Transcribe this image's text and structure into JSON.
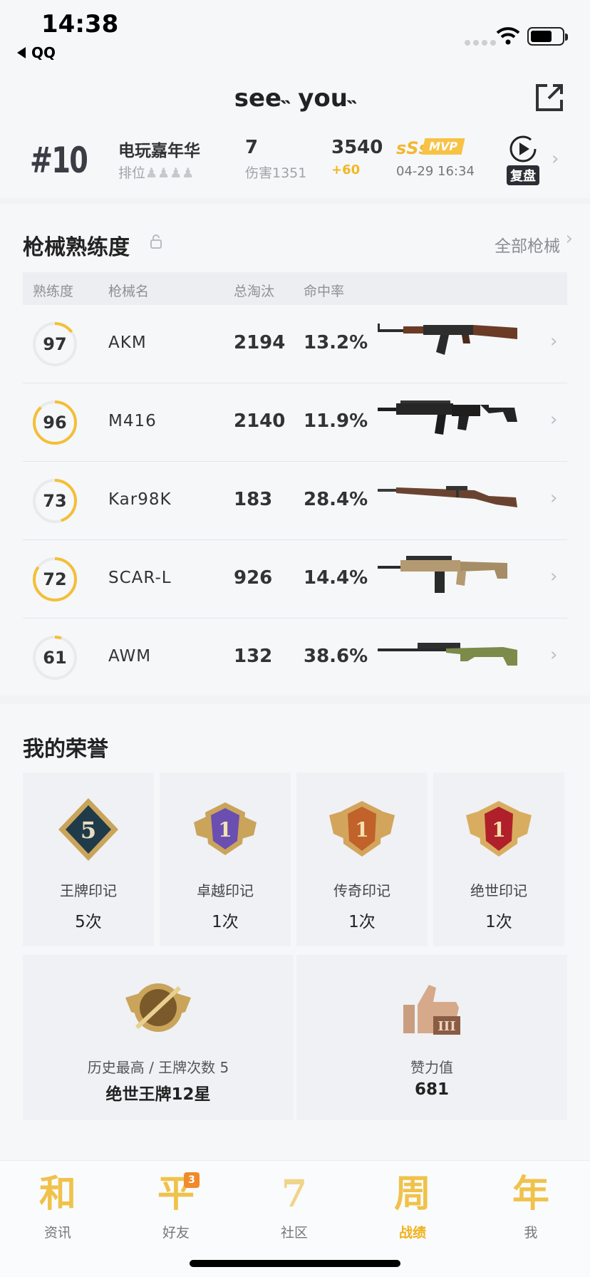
{
  "status_bar": {
    "time": "14:38",
    "back_label": "QQ"
  },
  "header": {
    "title": "see˵ you˵",
    "match": {
      "rank": "#10",
      "mode": "电玩嘉年华",
      "rank_label": "排位",
      "kills": "7",
      "damage": "伤害1351",
      "score": "3540",
      "score_delta": "+60",
      "grade": "sSs",
      "mvp": "MVP",
      "time": "04-29 16:34",
      "replay_label": "复盘"
    }
  },
  "weapons": {
    "title": "枪械熟练度",
    "all_link": "全部枪械",
    "columns": [
      "熟练度",
      "枪械名",
      "总淘汰",
      "命中率"
    ],
    "rows": [
      {
        "level": "97",
        "progress": 0.15,
        "name": "AKM",
        "kills": "2194",
        "accuracy": "13.2%",
        "icon": "akm-rifle"
      },
      {
        "level": "96",
        "progress": 0.88,
        "name": "M416",
        "kills": "2140",
        "accuracy": "11.9%",
        "icon": "m416-rifle"
      },
      {
        "level": "73",
        "progress": 0.45,
        "name": "Kar98K",
        "kills": "183",
        "accuracy": "28.4%",
        "icon": "kar98k-rifle"
      },
      {
        "level": "72",
        "progress": 0.85,
        "name": "SCAR-L",
        "kills": "926",
        "accuracy": "14.4%",
        "icon": "scar-l-rifle"
      },
      {
        "level": "61",
        "progress": 0.05,
        "name": "AWM",
        "kills": "132",
        "accuracy": "38.6%",
        "icon": "awm-sniper"
      }
    ]
  },
  "honor": {
    "title": "我的荣誉",
    "badges": [
      {
        "label": "王牌印记",
        "count": "5次",
        "icon": "ace-mark-icon",
        "emblem": "5"
      },
      {
        "label": "卓越印记",
        "count": "1次",
        "icon": "excellence-mark-icon",
        "emblem": "1"
      },
      {
        "label": "传奇印记",
        "count": "1次",
        "icon": "legend-mark-icon",
        "emblem": "1"
      },
      {
        "label": "绝世印记",
        "count": "1次",
        "icon": "peerless-mark-icon",
        "emblem": "1"
      }
    ],
    "stats": [
      {
        "label": "历史最高 / 王牌次数 5",
        "value": "绝世王牌12星",
        "icon": "highest-tier-icon"
      },
      {
        "label": "赞力值",
        "value": "681",
        "icon": "thumbs-up-icon"
      }
    ]
  },
  "tabbar": {
    "tabs": [
      {
        "glyph": "和",
        "label": "资讯",
        "active": false
      },
      {
        "glyph": "平",
        "label": "好友",
        "badge": "3",
        "active": false
      },
      {
        "glyph": "7",
        "label": "社区",
        "active": false
      },
      {
        "glyph": "周",
        "label": "战绩",
        "active": true
      },
      {
        "glyph": "年",
        "label": "我",
        "active": false
      }
    ]
  },
  "colors": {
    "accent": "#f2b824",
    "ring_track": "#e9eaec",
    "ring_fill": "#f4bf36"
  }
}
